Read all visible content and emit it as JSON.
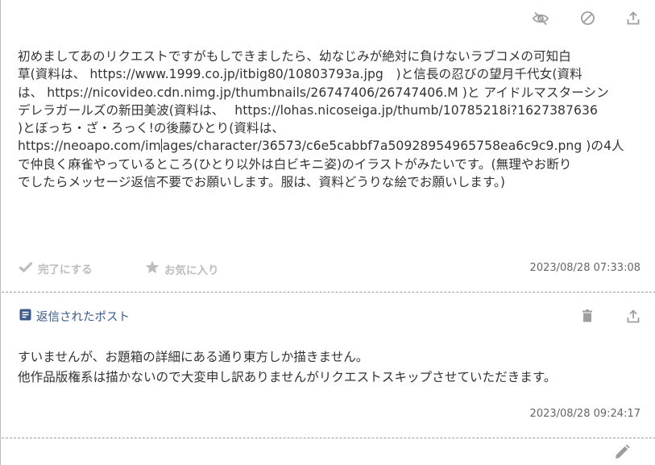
{
  "post": {
    "lines": [
      "初めましてあのリクエストですがもしできましたら、幼なじみが絶対に負けないラブコメの可知白",
      "草(資料は、 https://www.1999.co.jp/itbig80/10803793a.jpg　)と信長の忍びの望月千代女(資料",
      "は、 https://nicovideo.cdn.nimg.jp/thumbnails/26747406/26747406.M )と アイドルマスターシン",
      "デレラガールズの新田美波(資料は、　 https://lohas.nicoseiga.jp/thumb/10785218i?1627387636",
      ")とぼっち・ざ・ろっく!の後藤ひとり(資料は、",
      "https://neoapo.com/images/character/36573/c6e5cabbf7a50928954965758ea6c9c9.png )の4人",
      "で仲良く麻雀やっているところ(ひとり以外は白ビキニ姿)のイラストがみたいです。(無理やお断り",
      "でしたらメッセージ返信不要でお願いします。服は、資料どうりな絵でお願いします。)"
    ],
    "line6_before_cursor": "https://neoapo.com/im",
    "line6_after_cursor": "ages/character/36573/c6e5cabbf7a50928954965758ea6c9c9.png )の4人",
    "complete_label": "完了にする",
    "favorite_label": "お気に入り",
    "timestamp": "2023/08/28 07:33:08",
    "icons": [
      "eye-off-icon",
      "block-icon",
      "share-icon"
    ]
  },
  "reply": {
    "title": "返信されたポスト",
    "lines": [
      "すいませんが、お題箱の詳細にある通り東方しか描きません。",
      "他作品版権系は描かないので大変申し訳ありませんがリクエストスキップさせていただきます。"
    ],
    "timestamp": "2023/08/28 09:24:17",
    "icons": [
      "trash-icon",
      "share-icon"
    ]
  },
  "footer": {
    "icons": [
      "pencil-icon"
    ]
  },
  "colors": {
    "muted": "#bdbdbd",
    "icon": "#9e9e9e",
    "link": "#3b5a8c",
    "text": "#333333"
  }
}
